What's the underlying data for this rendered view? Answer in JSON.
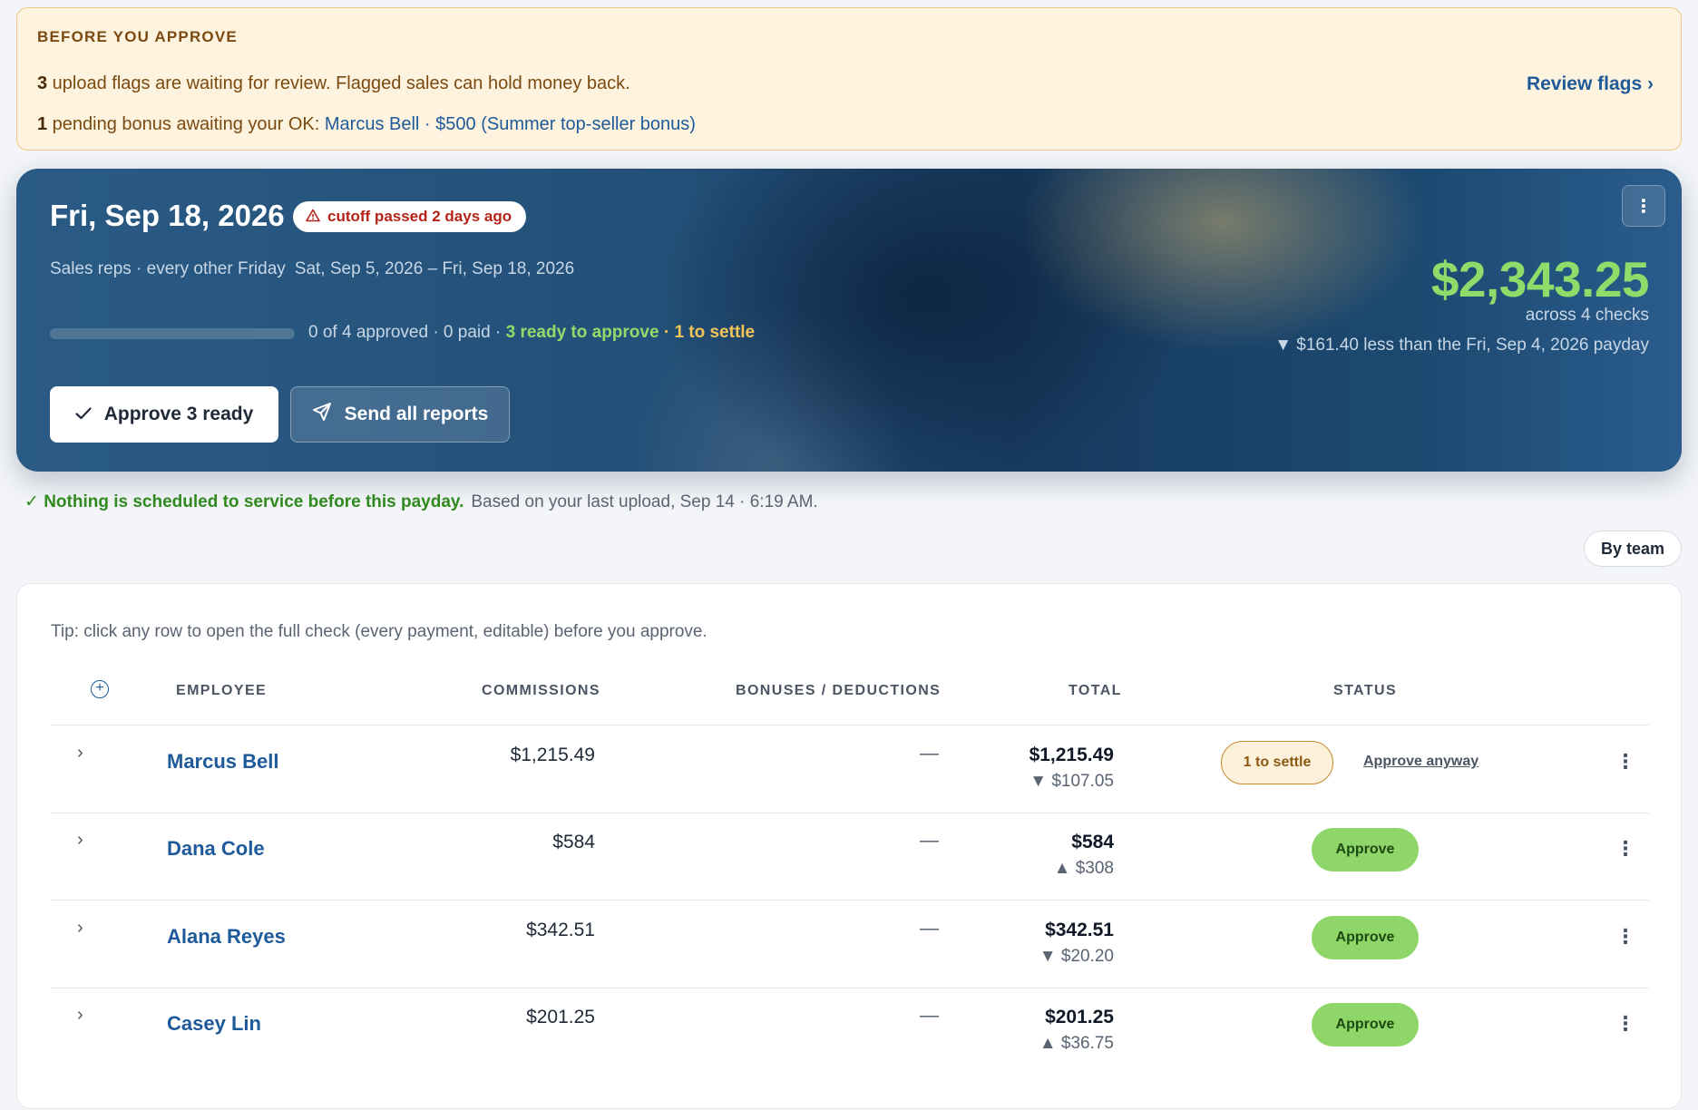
{
  "alert": {
    "title": "BEFORE YOU APPROVE",
    "flags_count": "3",
    "flags_text": " upload flags are waiting for review. Flagged sales can hold money back.",
    "bonus_count": "1",
    "bonus_text": " pending bonus awaiting your OK: ",
    "bonus_employee": "Marcus Bell",
    "bonus_separator": " · ",
    "bonus_detail": "$500 (Summer top-seller bonus)",
    "review_link": "Review flags ›"
  },
  "hero": {
    "date": "Fri, Sep 18, 2026",
    "cutoff_badge": "cutoff passed 2 days ago",
    "schedule": "Sales reps · every other Friday",
    "period": "Sat, Sep 5, 2026 – Fri, Sep 18, 2026",
    "progress_fraction": 0,
    "progress_status": "0 of 4 approved · 0 paid · ",
    "ready_text": "3 ready to approve",
    "settle_sep": " · ",
    "settle_text": "1 to settle",
    "approve_all_label": "Approve 3 ready",
    "send_reports_label": "Send all reports",
    "menu_label": "⋮",
    "total_amount": "$2,343.25",
    "checks_count": "across 4 checks",
    "diff_text": "▼ $161.40 less than the Fri, Sep 4, 2026 payday"
  },
  "service": {
    "ok_text": "✓ Nothing is scheduled to service before this payday.",
    "based_on": "Based on your last upload, Sep 14 · 6:19 AM."
  },
  "view_toggle": "By team",
  "table": {
    "tip": "Tip: click any row to open the full check (every payment, editable) before you approve.",
    "headers": {
      "employee": "EMPLOYEE",
      "commissions": "COMMISSIONS",
      "bonuses": "BONUSES / DEDUCTIONS",
      "total": "TOTAL",
      "status": "STATUS"
    },
    "rows": [
      {
        "name": "Marcus Bell",
        "commissions": "$1,215.49",
        "bonuses": "—",
        "total": "$1,215.49",
        "diff": "▼ $107.05",
        "status": "1 to settle",
        "status_action": "Approve anyway"
      },
      {
        "name": "Dana Cole",
        "commissions": "$584",
        "bonuses": "—",
        "total": "$584",
        "diff": "▲ $308",
        "status": "Approve"
      },
      {
        "name": "Alana Reyes",
        "commissions": "$342.51",
        "bonuses": "—",
        "total": "$342.51",
        "diff": "▼ $20.20",
        "status": "Approve"
      },
      {
        "name": "Casey Lin",
        "commissions": "$201.25",
        "bonuses": "—",
        "total": "$201.25",
        "diff": "▲ $36.75",
        "status": "Approve"
      }
    ]
  },
  "colors": {
    "accent_link": "#1e5a99",
    "ready_green": "#8fdc6a",
    "settle_amber": "#f3c558",
    "alert_bg": "#fef3df",
    "danger": "#b42318"
  }
}
